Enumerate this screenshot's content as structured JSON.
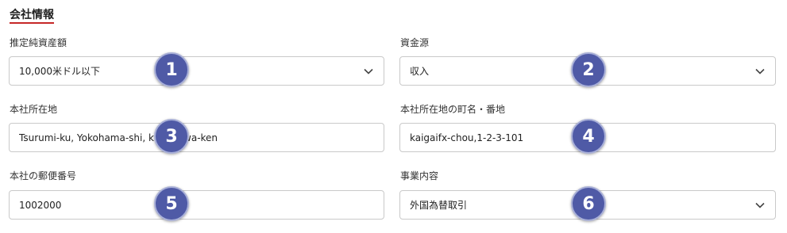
{
  "section": {
    "title": "会社情報",
    "accent_color": "#c62828"
  },
  "fields": {
    "net_assets": {
      "label": "推定純資産額",
      "value": "10,000米ドル以下",
      "type": "select"
    },
    "fund_source": {
      "label": "資金源",
      "value": "収入",
      "type": "select"
    },
    "hq_location": {
      "label": "本社所在地",
      "value": "Tsurumi-ku, Yokohama-shi, kanagawa-ken",
      "type": "text"
    },
    "hq_street": {
      "label": "本社所在地の町名・番地",
      "value": "kaigaifx-chou,1-2-3-101",
      "type": "text"
    },
    "hq_postal": {
      "label": "本社の郵便番号",
      "value": "1002000",
      "type": "text"
    },
    "business": {
      "label": "事業内容",
      "value": "外国為替取引",
      "type": "select"
    }
  },
  "badges": [
    "1",
    "2",
    "3",
    "4",
    "5",
    "6"
  ],
  "colors": {
    "badge_fill": "#4f5aa6",
    "badge_ring": "#a9b0d8",
    "border": "#c9c9c9"
  }
}
